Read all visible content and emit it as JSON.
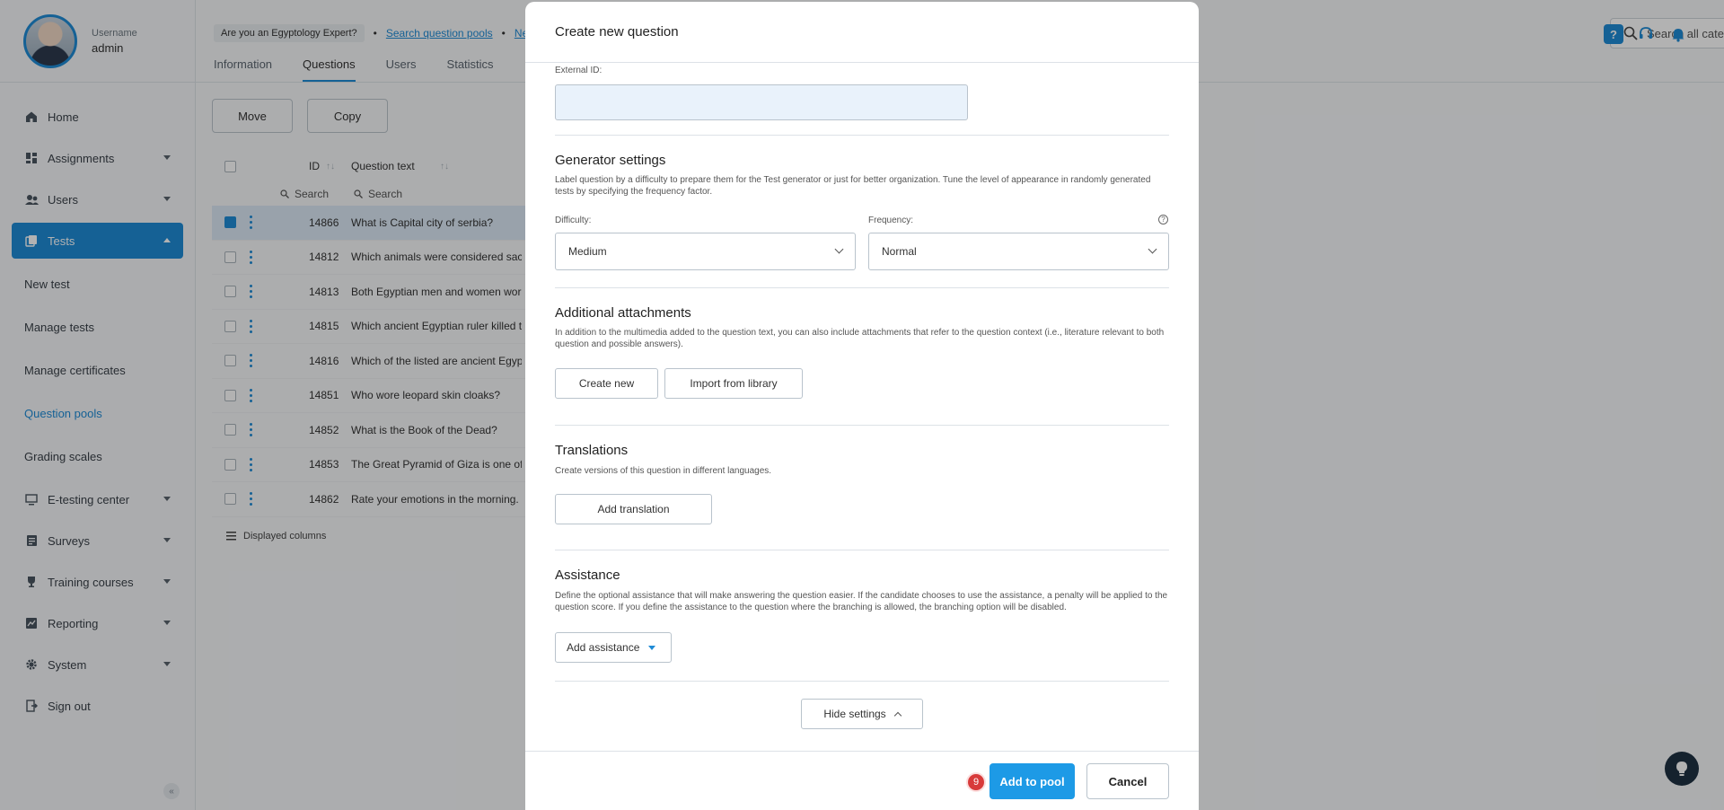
{
  "user": {
    "label": "Username",
    "name": "admin"
  },
  "sidebar": {
    "items": [
      {
        "label": "Home",
        "icon": "home-icon"
      },
      {
        "label": "Assignments",
        "icon": "dashboard-icon"
      },
      {
        "label": "Users",
        "icon": "users-icon"
      },
      {
        "label": "Tests",
        "icon": "tests-icon"
      }
    ],
    "sub_items": [
      "New test",
      "Manage tests",
      "Manage certificates",
      "Question pools",
      "Grading scales"
    ],
    "items_after": [
      {
        "label": "E-testing center",
        "icon": "monitor-icon"
      },
      {
        "label": "Surveys",
        "icon": "survey-icon"
      },
      {
        "label": "Training courses",
        "icon": "trophy-icon"
      },
      {
        "label": "Reporting",
        "icon": "chart-icon"
      },
      {
        "label": "System",
        "icon": "gear-icon"
      },
      {
        "label": "Sign out",
        "icon": "sign-out-icon"
      }
    ],
    "collapse": "«"
  },
  "header": {
    "pool_name": "Are you an Egyptology Expert?",
    "breadcrumb_link": "Search question pools",
    "breadcrumb_next": "Ne",
    "tabs": [
      "Information",
      "Questions",
      "Users",
      "Statistics"
    ],
    "search_placeholder": "Search all categories"
  },
  "toolbar": {
    "move": "Move",
    "copy": "Copy"
  },
  "table": {
    "columns": [
      "ID",
      "Question text"
    ],
    "search_placeholder": "Search",
    "rows": [
      {
        "id": "14866",
        "text": "What is Capital city of serbia?",
        "selected": true
      },
      {
        "id": "14812",
        "text": "Which animals were considered sac"
      },
      {
        "id": "14813",
        "text": "Both Egyptian men and women wore"
      },
      {
        "id": "14815",
        "text": "Which ancient Egyptian ruler killed t"
      },
      {
        "id": "14816",
        "text": "Which of the listed are ancient Egyp"
      },
      {
        "id": "14851",
        "text": "Who wore leopard skin cloaks?"
      },
      {
        "id": "14852",
        "text": "What is the Book of the Dead?"
      },
      {
        "id": "14853",
        "text": "The Great Pyramid of Giza is one of"
      },
      {
        "id": "14862",
        "text": "Rate your emotions in the morning."
      }
    ],
    "displayed_columns": "Displayed columns"
  },
  "modal": {
    "title": "Create new question",
    "external_id_label": "External ID:",
    "external_id_value": "",
    "generator": {
      "title": "Generator settings",
      "desc": "Label question by a difficulty to prepare them for the Test generator or just for better organization. Tune the level of appearance in randomly generated tests by specifying the frequency factor.",
      "difficulty_label": "Difficulty:",
      "difficulty_value": "Medium",
      "frequency_label": "Frequency:",
      "frequency_value": "Normal"
    },
    "attachments": {
      "title": "Additional attachments",
      "desc": "In addition to the multimedia added to the question text, you can also include attachments that refer to the question context (i.e., literature relevant to both question and possible answers).",
      "create_new": "Create new",
      "import": "Import from library"
    },
    "translations": {
      "title": "Translations",
      "desc": "Create versions of this question in different languages.",
      "add": "Add translation"
    },
    "assistance": {
      "title": "Assistance",
      "desc": "Define the optional assistance that will make answering the question easier. If the candidate chooses to use the assistance, a penalty will be applied to the question score. If you define the assistance to the question where the branching is allowed, the branching option will be disabled.",
      "add": "Add assistance"
    },
    "hide_settings": "Hide settings",
    "footer": {
      "badge": "9",
      "add_to_pool": "Add to pool",
      "cancel": "Cancel"
    }
  },
  "colors": {
    "accent": "#1f8bd6",
    "primary_button": "#1d9ae6",
    "badge": "#d83b3b"
  }
}
